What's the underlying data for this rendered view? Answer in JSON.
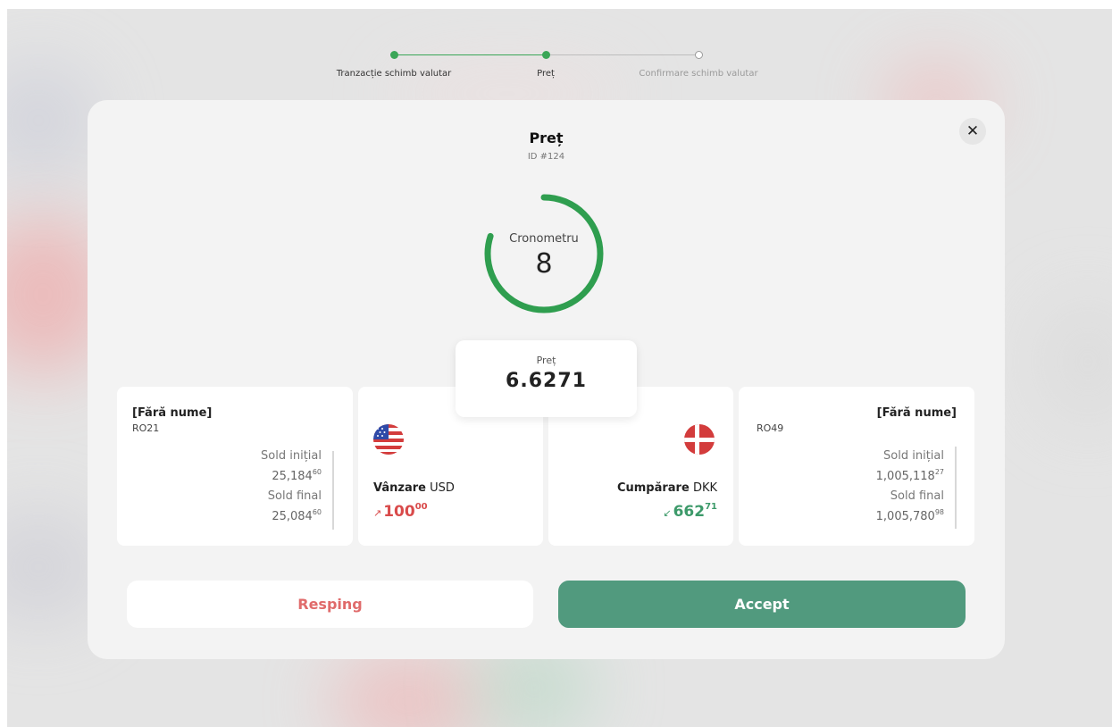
{
  "stepper": {
    "steps": [
      {
        "label": "Tranzacție schimb valutar",
        "state": "done"
      },
      {
        "label": "Preț",
        "state": "active"
      },
      {
        "label": "Confirmare schimb valutar",
        "state": "pending"
      }
    ]
  },
  "modal": {
    "title": "Preț",
    "id_label": "ID #124",
    "close_icon": "close-icon",
    "timer": {
      "label": "Cronometru",
      "value": "8",
      "progress_fraction": 0.8
    }
  },
  "price": {
    "label": "Preț",
    "value": "6.6271"
  },
  "source_account": {
    "name": "[Fără nume]",
    "iban": "RO21",
    "initial_label": "Sold inițial",
    "initial_int": "25,184",
    "initial_dec": "60",
    "final_label": "Sold final",
    "final_int": "25,084",
    "final_dec": "60"
  },
  "sell": {
    "flag_icon": "us-flag-icon",
    "action": "Vânzare",
    "currency": "USD",
    "arrow": "↗",
    "amount_int": "100",
    "amount_dec": "00"
  },
  "buy": {
    "flag_icon": "dk-flag-icon",
    "action": "Cumpărare",
    "currency": "DKK",
    "arrow": "↙",
    "amount_int": "662",
    "amount_dec": "71"
  },
  "target_account": {
    "name": "[Fără nume]",
    "iban": "RO49",
    "initial_label": "Sold inițial",
    "initial_int": "1,005,118",
    "initial_dec": "27",
    "final_label": "Sold final",
    "final_int": "1,005,780",
    "final_dec": "98"
  },
  "actions": {
    "reject_label": "Resping",
    "accept_label": "Accept"
  },
  "colors": {
    "accent_green": "#519a7e",
    "timer_green": "#2f9e4f",
    "sell_red": "#d94b4b",
    "buy_green": "#3d9a6a",
    "reject_text": "#e06b6b"
  }
}
